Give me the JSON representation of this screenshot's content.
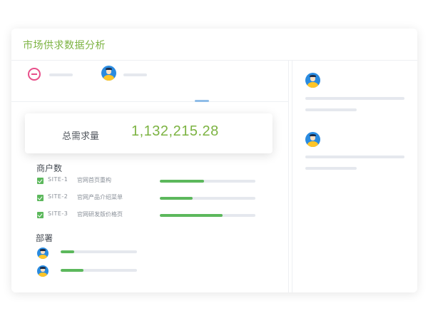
{
  "header": {
    "title": "市场供求数据分析"
  },
  "summary": {
    "total_label": "总需求量",
    "total_value": "1,132,215.28"
  },
  "merchants": {
    "title": "商户数",
    "items": [
      {
        "code": "SITE-1",
        "name": "官网首页重构",
        "progress": 0.46
      },
      {
        "code": "SITE-2",
        "name": "官网产品介绍菜单",
        "progress": 0.34
      },
      {
        "code": "SITE-3",
        "name": "官网研发版价格页",
        "progress": 0.66
      }
    ]
  },
  "deployment": {
    "title": "部署",
    "items": [
      {
        "progress": 0.18
      },
      {
        "progress": 0.3
      }
    ]
  },
  "colors": {
    "accent": "#7cb342",
    "progress": "#5cb85c",
    "alert": "#e84f8a",
    "avatar": "#2a8be0"
  },
  "icons": {
    "remove": "minus-circle-icon",
    "user": "user-avatar-icon",
    "check": "checkbox-checked-icon"
  }
}
